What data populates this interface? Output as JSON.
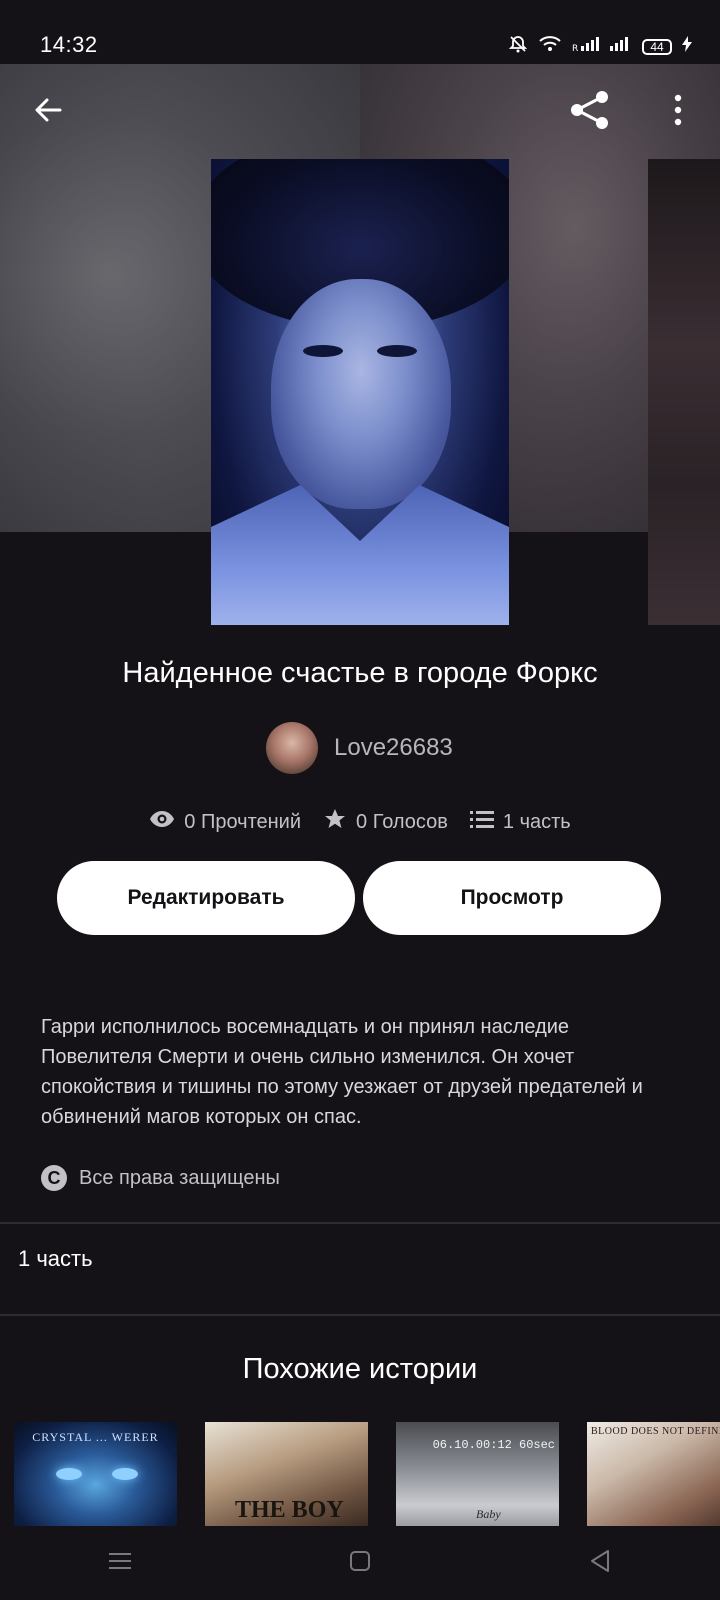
{
  "status_bar": {
    "time": "14:32",
    "battery": "44",
    "icons": [
      "bell-off-icon",
      "wifi-icon",
      "signal-roaming-icon",
      "signal-icon",
      "battery-icon",
      "charging-icon"
    ]
  },
  "toolbar": {
    "back_icon": "arrow-left-icon",
    "share_icon": "share-icon",
    "more_icon": "more-vertical-icon"
  },
  "story": {
    "title": "Найденное счастье в городе Форкс",
    "author": "Love26683",
    "reads": "0 Прочтений",
    "votes": "0 Голосов",
    "parts": "1 часть",
    "description": "Гарри исполнилось восемнадцать и он принял наследие Повелителя Смерти и очень сильно изменился. Он хочет спокойствия и тишины по этому уезжает от друзей предателей и обвинений магов которых он спас.",
    "copyright": "Все права защищены"
  },
  "actions": {
    "edit_label": "Редактировать",
    "preview_label": "Просмотр"
  },
  "parts_section": {
    "label": "1 часть"
  },
  "similar": {
    "title": "Похожие истории",
    "covers": [
      {
        "text": "CRYSTAL ... WERER"
      },
      {
        "text": "THE BOY"
      },
      {
        "text": "06.10.00:12 60sec",
        "sub": "Baby"
      },
      {
        "text": "BLOOD DOES NOT DEFINE F..."
      }
    ]
  },
  "colors": {
    "background": "#141216",
    "button_bg": "#ffffff",
    "button_text": "#141216",
    "muted_text": "#c3c1c6"
  }
}
